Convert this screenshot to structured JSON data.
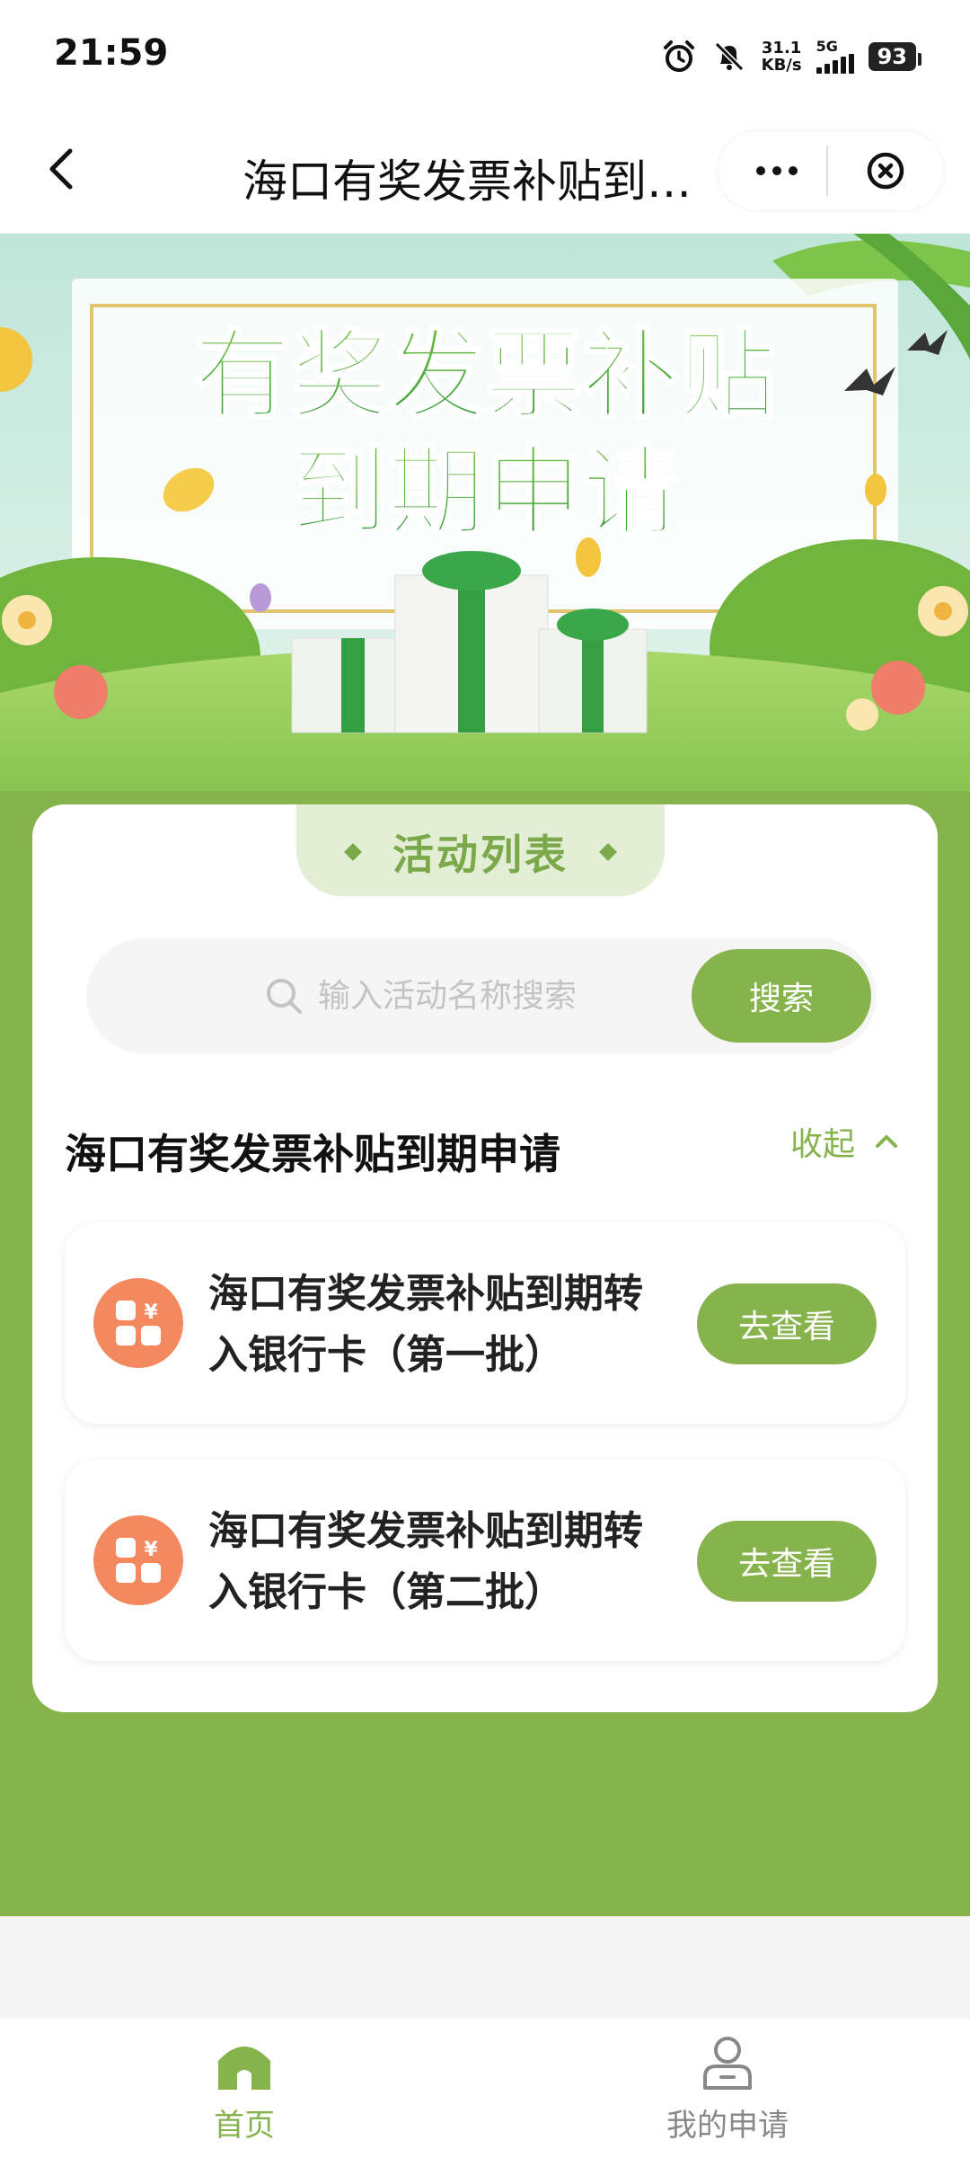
{
  "status_bar": {
    "time": "21:59",
    "net_speed_value": "31.1",
    "net_speed_unit": "KB/s",
    "network": "5G",
    "battery": "93"
  },
  "nav": {
    "title": "海口有奖发票补贴到…"
  },
  "banner": {
    "line1": "有奖发票补贴",
    "line2": "到期申请"
  },
  "list_tab": {
    "label": "活动列表"
  },
  "search": {
    "placeholder": "输入活动名称搜索",
    "value": "",
    "button_label": "搜索"
  },
  "section": {
    "title": "海口有奖发票补贴到期申请",
    "collapse_label": "收起"
  },
  "activities": [
    {
      "title": "海口有奖发票补贴到期转入银行卡（第一批）",
      "button": "去查看"
    },
    {
      "title": "海口有奖发票补贴到期转入银行卡（第二批）",
      "button": "去查看"
    }
  ],
  "tab_bar": {
    "items": [
      {
        "label": "首页",
        "active": true
      },
      {
        "label": "我的申请",
        "active": false
      }
    ]
  },
  "colors": {
    "accent": "#86b34c",
    "tab_light": "#e2efd5",
    "icon_orange": "#f4885f",
    "inactive_tab": "#888888"
  }
}
